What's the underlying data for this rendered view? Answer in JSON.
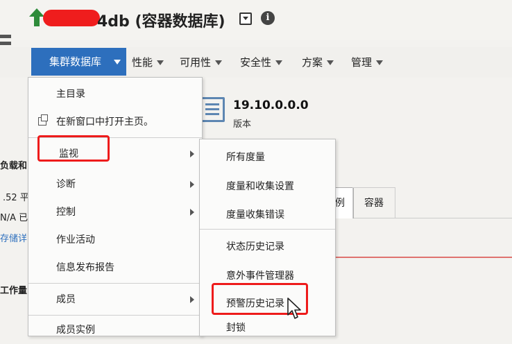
{
  "title": {
    "text": "4db (容器数据库)",
    "info_glyph": "i"
  },
  "menubar": {
    "items": [
      {
        "label": "集群数据库",
        "active": true
      },
      {
        "label": "性能"
      },
      {
        "label": "可用性"
      },
      {
        "label": "安全性"
      },
      {
        "label": "方案"
      },
      {
        "label": "管理"
      }
    ]
  },
  "page": {
    "version_number": "19.10.0.0.0",
    "version_label": "版本",
    "left_fragments": [
      "负载和",
      ".52 平",
      "N/A 已",
      "存储详",
      "工作量"
    ],
    "tabs": [
      "例",
      "容器"
    ]
  },
  "dropdown": {
    "items": [
      {
        "label": "主目录"
      },
      {
        "label": "在新窗口中打开主页。",
        "icon": "new-window-icon"
      },
      {
        "label": "监视",
        "submenu": true
      },
      {
        "label": "诊断",
        "submenu": true
      },
      {
        "label": "控制",
        "submenu": true
      },
      {
        "label": "作业活动"
      },
      {
        "label": "信息发布报告"
      },
      {
        "label": "成员",
        "submenu": true
      },
      {
        "label": "成员实例"
      }
    ]
  },
  "submenu": {
    "items": [
      {
        "label": "所有度量"
      },
      {
        "label": "度量和收集设置"
      },
      {
        "label": "度量收集错误"
      },
      {
        "label": "状态历史记录"
      },
      {
        "label": "意外事件管理器"
      },
      {
        "label": "预警历史记录"
      },
      {
        "label": "封锁"
      }
    ]
  },
  "colors": {
    "accent": "#2d6fbd",
    "highlight": "#ee1b1b",
    "uptime": "#2e8b3a"
  }
}
